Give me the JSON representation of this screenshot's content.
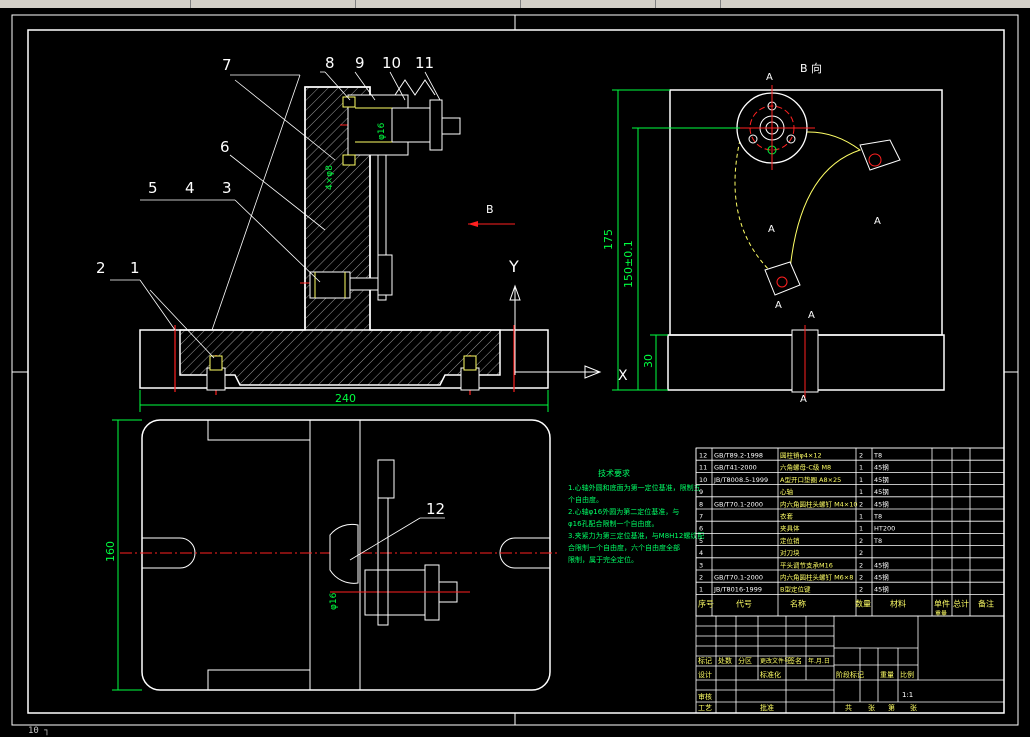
{
  "colors": {
    "background": "#000000",
    "outline": "#ffffff",
    "hatch": "#c0c0c0",
    "centerline": "#ff2020",
    "dimension": "#00ff40",
    "hidden": "#ffff66",
    "notes": "#00ff66"
  },
  "taskbar": {
    "items": [
      "",
      "",
      "",
      "",
      ""
    ]
  },
  "status": {
    "text": "10 ┐"
  },
  "front_view": {
    "callouts": [
      "1",
      "2",
      "3",
      "4",
      "5",
      "6",
      "7",
      "8",
      "9",
      "10",
      "11"
    ],
    "direction_label": "B",
    "axis_label": "Y",
    "axis_label_x": "X",
    "dim_width": "240",
    "dim_phi_a": "φ16",
    "dim_phi_b": "4×φ8"
  },
  "side_view": {
    "view_label": "B 向",
    "section_marks": [
      "A",
      "A",
      "A",
      "A",
      "A",
      "A"
    ],
    "dim_overall": "175",
    "dim_center": "150±0.1",
    "dim_base": "30"
  },
  "top_view": {
    "dim_height": "160",
    "callout": "12",
    "dim_phi": "φ16"
  },
  "notes": {
    "title": "技术要求",
    "lines": [
      "1.心轴外圆和底面为第一定位基准，限制五",
      "个自由度。",
      "2.心轴φ16外圆为第二定位基准，与",
      "φ16孔配合限制一个自由度。",
      "3.夹紧力为第三定位基准，与M8H12螺纹配",
      "合限制一个自由度，六个自由度全部",
      "限制，属于完全定位。"
    ]
  },
  "bom": {
    "rows": [
      {
        "no": "12",
        "code": "GB/T89.2-1998",
        "name": "圆柱销φ4×12",
        "qty": "2",
        "mat": "T8"
      },
      {
        "no": "11",
        "code": "GB/T41-2000",
        "name": "六角螺母-C级 M8",
        "qty": "1",
        "mat": "45钢"
      },
      {
        "no": "10",
        "code": "JB/T8008.5-1999",
        "name": "A型开口垫圈 A8×25",
        "qty": "1",
        "mat": "45钢"
      },
      {
        "no": "9",
        "code": "",
        "name": "心轴",
        "qty": "1",
        "mat": "45钢"
      },
      {
        "no": "8",
        "code": "GB/T70.1-2000",
        "name": "内六角圆柱头螺钉 M4×10",
        "qty": "2",
        "mat": "45钢"
      },
      {
        "no": "7",
        "code": "",
        "name": "衣套",
        "qty": "1",
        "mat": "T8"
      },
      {
        "no": "6",
        "code": "",
        "name": "夹具体",
        "qty": "1",
        "mat": "HT200"
      },
      {
        "no": "5",
        "code": "",
        "name": "定位销",
        "qty": "2",
        "mat": "T8"
      },
      {
        "no": "4",
        "code": "",
        "name": "对刀块",
        "qty": "2",
        "mat": ""
      },
      {
        "no": "3",
        "code": "",
        "name": "平头调节支承M16",
        "qty": "2",
        "mat": "45钢"
      },
      {
        "no": "2",
        "code": "GB/T70.1-2000",
        "name": "内六角圆柱头螺钉 M6×8",
        "qty": "2",
        "mat": "45钢"
      },
      {
        "no": "1",
        "code": "JB/T8016-1999",
        "name": "B型定位键",
        "qty": "2",
        "mat": "45钢"
      }
    ],
    "header": {
      "no": "序号",
      "code": "代号",
      "name": "名称",
      "qty": "数量",
      "mat": "材料",
      "unit": "单件",
      "total": "总计",
      "weight": "重量",
      "remark": "备注"
    }
  },
  "title_block": {
    "rev_header": [
      "标记",
      "处数",
      "分区",
      "更改文件号",
      "签名",
      "年.月.日"
    ],
    "design": "设计",
    "standardize": "标准化",
    "review": "审核",
    "process": "工艺",
    "approve": "批准",
    "stage": "阶段标记",
    "weight": "重量",
    "scale": "比例",
    "scale_value": "1:1",
    "sheet_total": "共",
    "sheet_label": "张",
    "sheet_no": "第",
    "sheet_label2": "张"
  }
}
